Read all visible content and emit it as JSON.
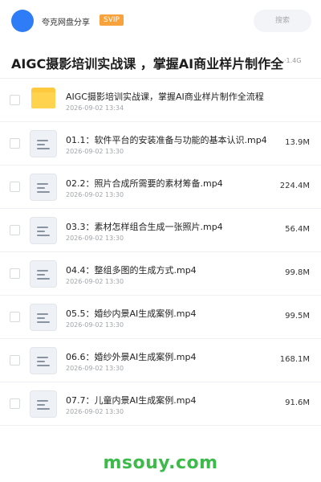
{
  "header": {
    "share_name": "夸克网盘分享",
    "badge": "SVIP",
    "search_placeholder": "搜索"
  },
  "folder": {
    "title": "AIGC摄影培训实战课 ，掌握AI商业样片制作全流程",
    "meta": "·1.4G"
  },
  "files": [
    {
      "name": "AIGC摄影培训实战课，掌握AI商业样片制作全流程",
      "date": "2026-09-02 13:34",
      "size": "",
      "type": "folder"
    },
    {
      "name": "01.1：软件平台的安装准备与功能的基本认识.mp4",
      "date": "2026-09-02 13:30",
      "size": "13.9M",
      "type": "video"
    },
    {
      "name": "02.2：照片合成所需要的素材筹备.mp4",
      "date": "2026-09-02 13:30",
      "size": "224.4M",
      "type": "video"
    },
    {
      "name": "03.3：素材怎样组合生成一张照片.mp4",
      "date": "2026-09-02 13:30",
      "size": "56.4M",
      "type": "video"
    },
    {
      "name": "04.4：整组多图的生成方式.mp4",
      "date": "2026-09-02 13:30",
      "size": "99.8M",
      "type": "video"
    },
    {
      "name": "05.5：婚纱内景AI生成案例.mp4",
      "date": "2026-09-02 13:30",
      "size": "99.5M",
      "type": "video"
    },
    {
      "name": "06.6：婚纱外景AI生成案例.mp4",
      "date": "2026-09-02 13:30",
      "size": "168.1M",
      "type": "video"
    },
    {
      "name": "07.7：儿童内景AI生成案例.mp4",
      "date": "2026-09-02 13:30",
      "size": "91.6M",
      "type": "video"
    }
  ],
  "watermark": "msouy.com",
  "colors": {
    "avatar": "#2f7df6",
    "badge": "#f7a23b",
    "folder_icon": "#ffd34d",
    "watermark": "#3dbb4a"
  }
}
